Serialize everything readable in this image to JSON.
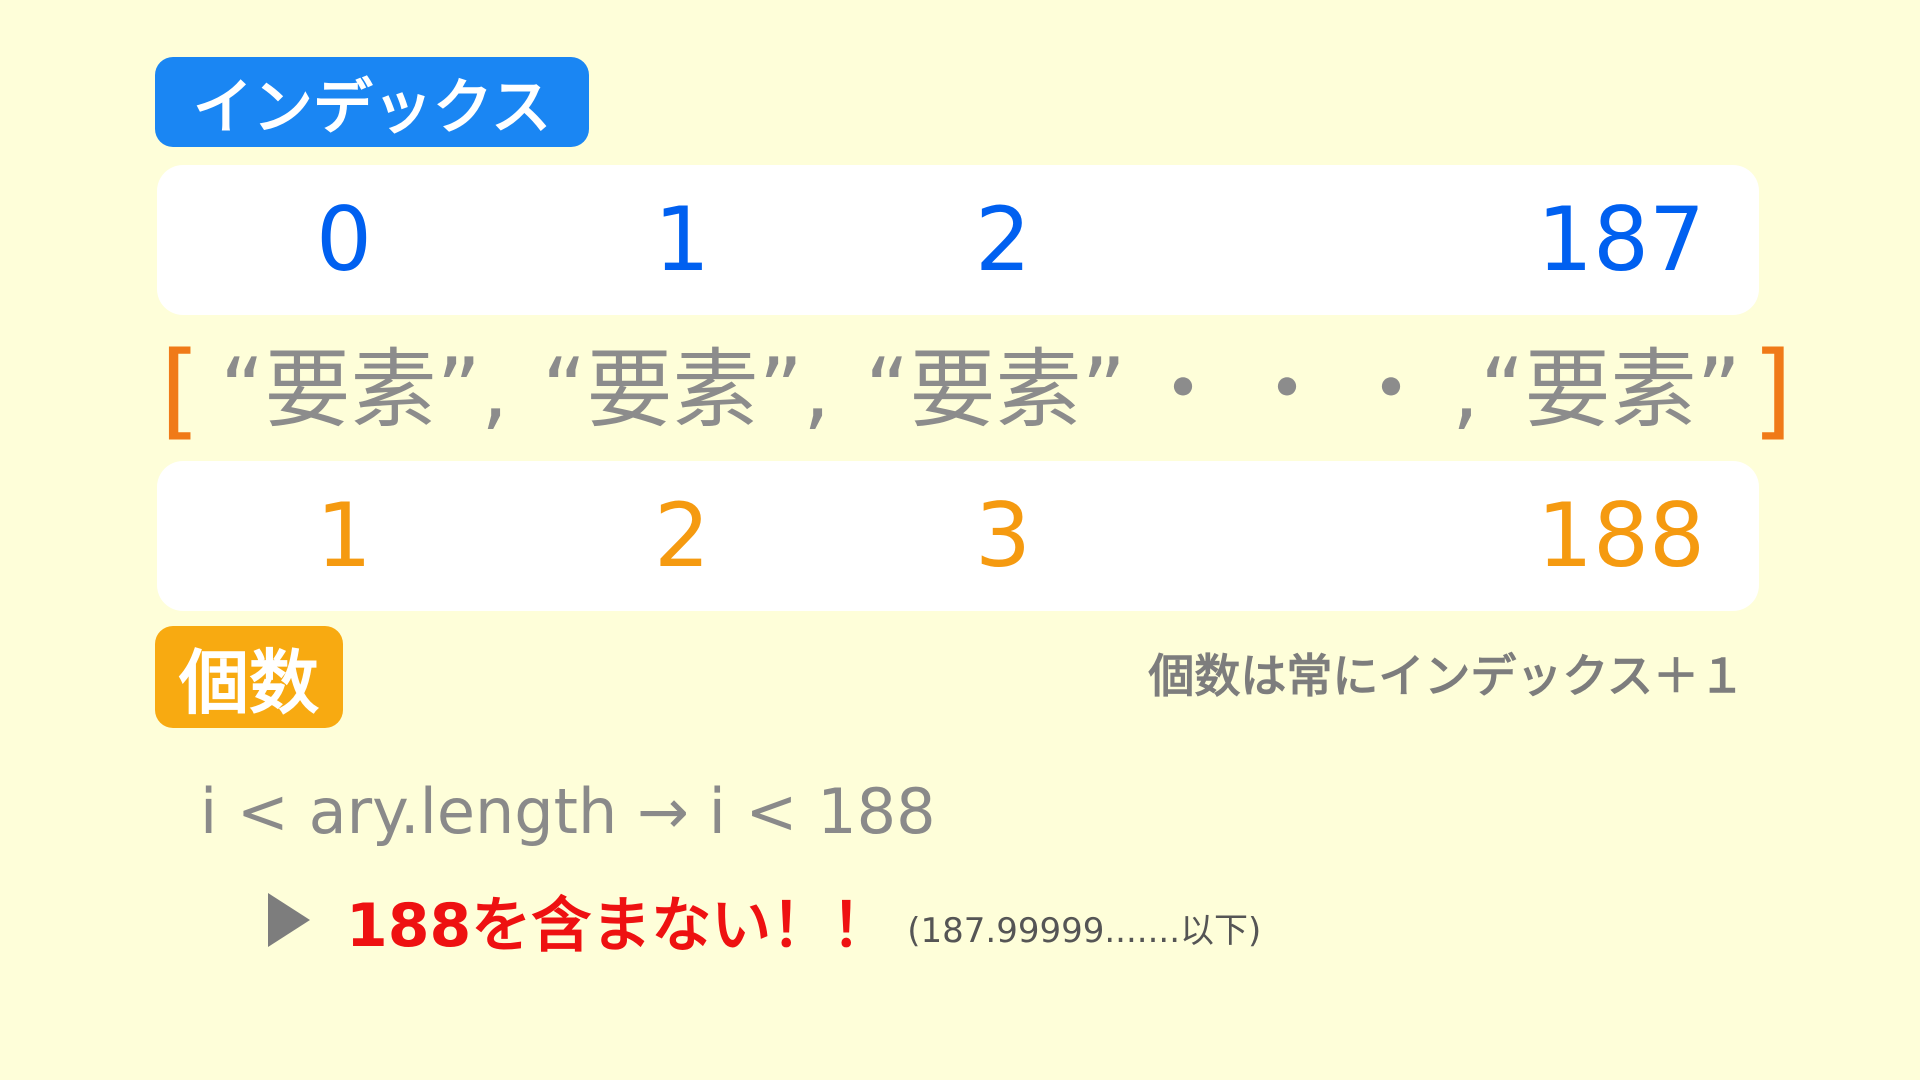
{
  "labels": {
    "index_badge": "インデックス",
    "count_badge": "個数"
  },
  "indices": [
    "0",
    "1",
    "2",
    "187"
  ],
  "counts": [
    "1",
    "2",
    "3",
    "188"
  ],
  "array": {
    "open_bracket": "[",
    "close_bracket": "]",
    "elements": [
      "“要素”,",
      "“要素”,",
      "“要素”",
      "“要素”"
    ],
    "ellipsis": "・・・,"
  },
  "note": "個数は常にインデックス＋１",
  "code": "i < ary.length → i < 188",
  "callout": {
    "main": "188を含まない！！",
    "sub": "(187.99999.......以下)"
  },
  "colors": {
    "background": "#fefed9",
    "index_blue": "#0060f0",
    "count_orange": "#f59a10",
    "badge_blue": "#1a86f3",
    "badge_orange": "#f8aa11",
    "bracket_orange": "#f07a18",
    "text_gray": "#8c8c8c",
    "alert_red": "#ee1111"
  },
  "icons": {
    "bullet": "play-triangle-icon"
  }
}
